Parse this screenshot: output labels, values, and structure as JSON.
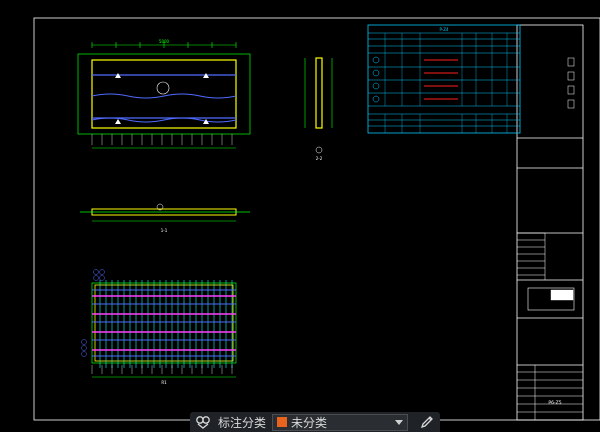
{
  "drawing": {
    "background": "#000000",
    "line_colors": {
      "frame": "#ffffff",
      "dimension": "#00ff00",
      "slab": "#ffff00",
      "rebar": "#00ffff",
      "blue": "#4f6bff",
      "magenta": "#ff40ff",
      "red": "#ff2020",
      "table": "#00c8ff"
    },
    "table_title_label": "P-Z4",
    "title_block_text": "P6-Z5",
    "plan_dim_label": "5000",
    "section_label": "1-1",
    "side_label": "2-2",
    "grid_label": "R1"
  },
  "toolbar": {
    "tags_icon": "tags-icon",
    "label": "标注分类",
    "selected_value": "未分类",
    "swatch_color": "#e8641e",
    "edit_icon": "edit-pen-icon"
  }
}
